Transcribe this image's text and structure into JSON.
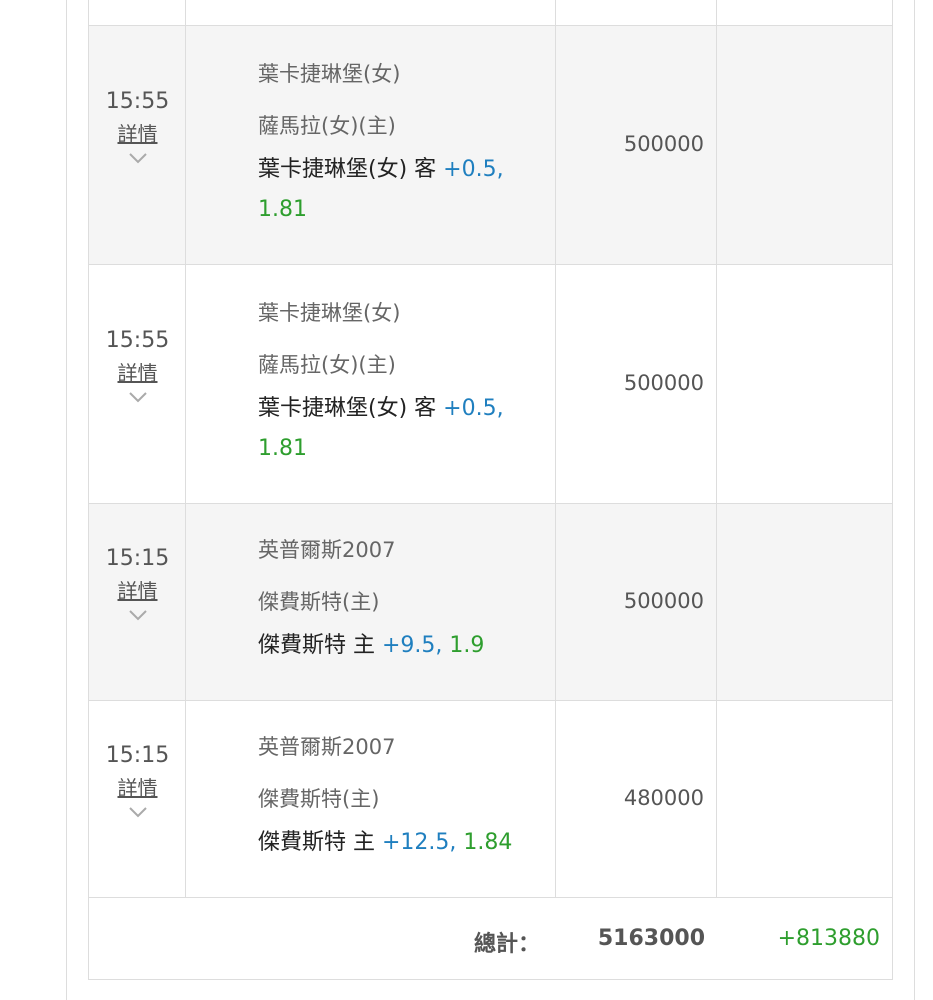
{
  "rows": [
    {
      "time": "15:55",
      "detail_label": "詳情",
      "team_a": "葉卡捷琳堡(女)",
      "team_b": "薩馬拉(女)(主)",
      "bet_team": "葉卡捷琳堡(女) 客",
      "handicap": "+0.5,",
      "odds": "1.81",
      "amount": "500000",
      "result": ""
    },
    {
      "time": "15:55",
      "detail_label": "詳情",
      "team_a": "葉卡捷琳堡(女)",
      "team_b": "薩馬拉(女)(主)",
      "bet_team": "葉卡捷琳堡(女) 客",
      "handicap": "+0.5,",
      "odds": "1.81",
      "amount": "500000",
      "result": ""
    },
    {
      "time": "15:15",
      "detail_label": "詳情",
      "team_a": "英普爾斯2007",
      "team_b": "傑費斯特(主)",
      "bet_team": "傑費斯特 主",
      "handicap": "+9.5,",
      "odds": "1.9",
      "amount": "500000",
      "result": ""
    },
    {
      "time": "15:15",
      "detail_label": "詳情",
      "team_a": "英普爾斯2007",
      "team_b": "傑費斯特(主)",
      "bet_team": "傑費斯特 主",
      "handicap": "+12.5,",
      "odds": "1.84",
      "amount": "480000",
      "result": ""
    }
  ],
  "total": {
    "label": "總計：",
    "amount": "5163000",
    "profit": "+813880"
  },
  "colors": {
    "handicap": "#1f7fbf",
    "odds_profit": "#2e9e2e",
    "row_alt": "#f5f5f5",
    "border": "#dddddd"
  }
}
